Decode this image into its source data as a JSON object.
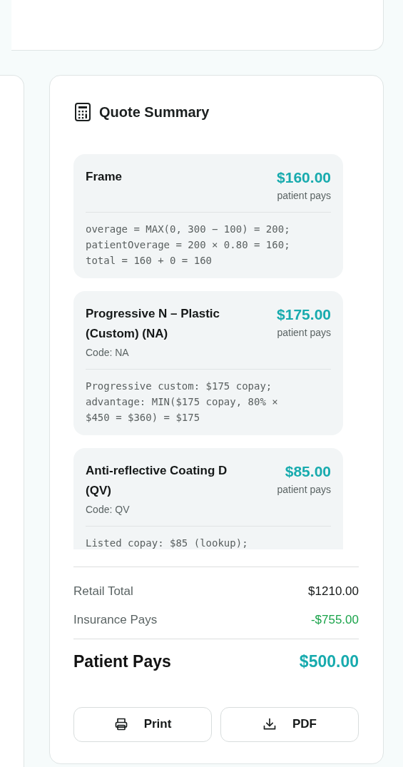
{
  "quote_summary": {
    "title": "Quote Summary",
    "items": [
      {
        "name": "Frame",
        "amount": "$160.00",
        "amount_caption": "patient pays",
        "note": "overage = MAX(0, 300 − 100) = 200;\npatientOverage = 200 × 0.80 = 160;\ntotal = 160 + 0 = 160"
      },
      {
        "name": "Progressive N – Plastic (Custom) (NA)",
        "code": "Code: NA",
        "amount": "$175.00",
        "amount_caption": "patient pays",
        "note": "Progressive custom: $175 copay;\nadvantage: MIN($175 copay, 80% ×\n$450 = $360) = $175"
      },
      {
        "name": "Anti-reflective Coating D (QV)",
        "code": "Code: QV",
        "amount": "$85.00",
        "amount_caption": "patient pays",
        "note": "Listed copay: $85 (lookup);"
      }
    ],
    "totals": [
      {
        "label": "Retail Total",
        "value": "$1210.00",
        "kind": "plain"
      },
      {
        "label": "Insurance Pays",
        "value": "-$755.00",
        "kind": "credit"
      }
    ],
    "grand_total": {
      "label": "Patient Pays",
      "value": "$500.00"
    },
    "buttons": [
      {
        "label": "Print",
        "kind": "print"
      },
      {
        "label": "PDF",
        "kind": "download"
      }
    ]
  }
}
